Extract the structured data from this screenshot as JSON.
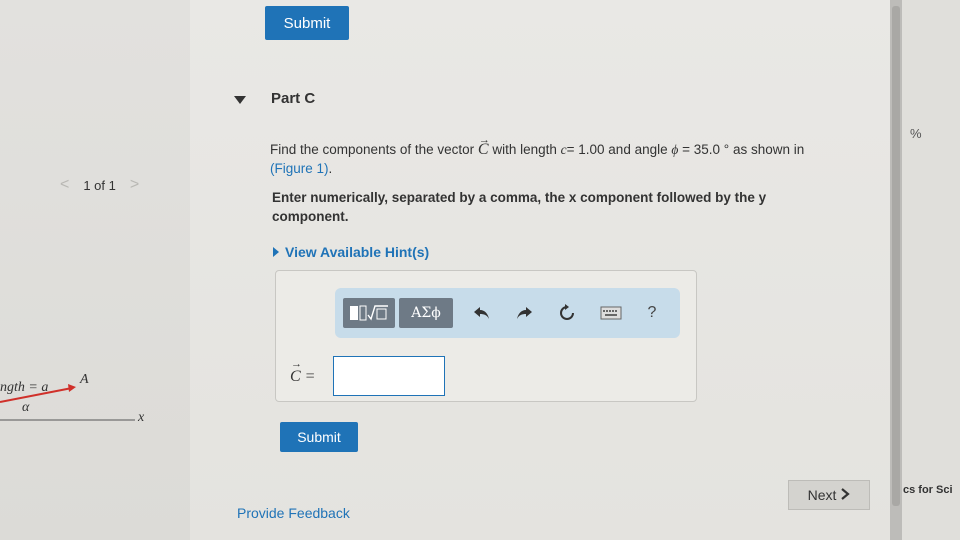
{
  "header": {
    "submit_label": "Submit"
  },
  "part": {
    "title": "Part C"
  },
  "pager": {
    "prev": "<",
    "label": "1 of 1",
    "next": ">"
  },
  "question": {
    "prefix": "Find the components of the vector",
    "vector_symbol": "C",
    "mid": "with length",
    "length_var": "c",
    "length_eq": "= 1.00 and angle",
    "angle_var": "ϕ",
    "angle_eq": "= 35.0 °",
    "suffix": "as shown in",
    "figure_link": "(Figure 1)",
    "period": "."
  },
  "instructions": "Enter numerically, separated by a comma, the x component followed by the y component.",
  "hints": {
    "label": "View Available Hint(s)"
  },
  "toolbar": {
    "templates_icon": "templates-icon",
    "symbols_label": "ΑΣϕ",
    "undo_icon": "undo-icon",
    "redo_icon": "redo-icon",
    "reset_icon": "reset-icon",
    "keyboard_icon": "keyboard-icon",
    "help_label": "?"
  },
  "answer": {
    "label": "C =",
    "value": ""
  },
  "footer": {
    "submit_label": "Submit",
    "feedback_label": "Provide Feedback",
    "next_label": "Next",
    "next_icon": "chevron-right-icon"
  },
  "right_panel": {
    "percent": "%",
    "footer_text": "cs for Sci"
  },
  "figure_fragment": {
    "length_text": "ngth = a",
    "vector_label": "A",
    "angle_label": "α",
    "axis_label": "x"
  },
  "colors": {
    "accent": "#1f73b7",
    "toolbar_bg": "#c7dcea",
    "vector_red": "#d0302a"
  }
}
